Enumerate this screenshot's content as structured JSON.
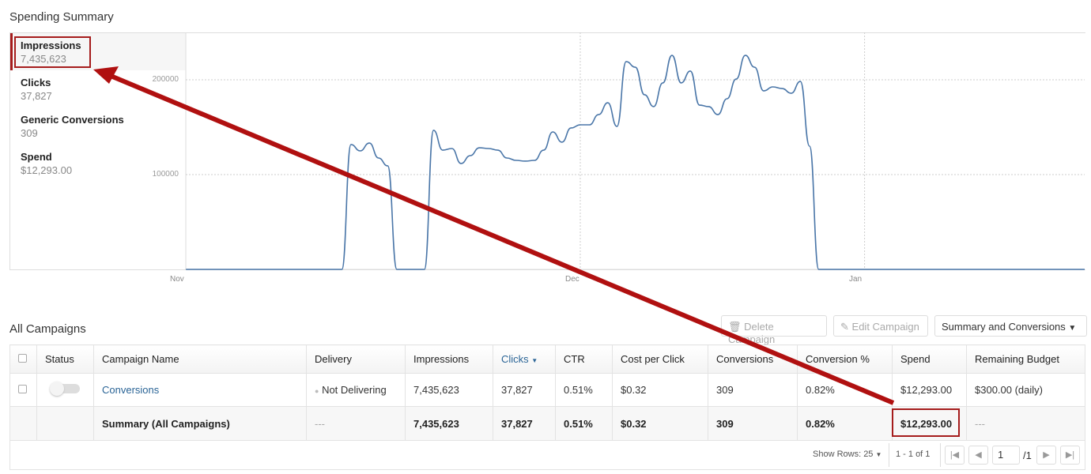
{
  "spending_title": "Spending Summary",
  "metrics": [
    {
      "name": "Impressions",
      "value": "7,435,623",
      "selected": true
    },
    {
      "name": "Clicks",
      "value": "37,827"
    },
    {
      "name": "Generic Conversions",
      "value": "309"
    },
    {
      "name": "Spend",
      "value": "$12,293.00"
    }
  ],
  "colors": {
    "line": "#4a76a8",
    "accent": "#a51c1c",
    "link": "#2a6496"
  },
  "chart_data": {
    "type": "line",
    "y_ticks": [
      "200000",
      "100000"
    ],
    "x_ticks": [
      "Nov",
      "Dec",
      "Jan"
    ],
    "ylim": [
      0,
      250000
    ],
    "xlim": [
      "Oct 19",
      "Jan 25"
    ],
    "grid": true,
    "series": [
      {
        "points": [
          [
            "Oct 19",
            0
          ],
          [
            "Nov 5",
            0
          ],
          [
            "Nov 6",
            131700
          ],
          [
            "Nov 7",
            125000
          ],
          [
            "Nov 8",
            133300
          ],
          [
            "Nov 9",
            117500
          ],
          [
            "Nov 10",
            109200
          ],
          [
            "Nov 11",
            0
          ],
          [
            "Nov 14",
            0
          ],
          [
            "Nov 15",
            146700
          ],
          [
            "Nov 16",
            125800
          ],
          [
            "Nov 17",
            127500
          ],
          [
            "Nov 18",
            111700
          ],
          [
            "Nov 19",
            120000
          ],
          [
            "Nov 20",
            128300
          ],
          [
            "Nov 21",
            127500
          ],
          [
            "Nov 22",
            125800
          ],
          [
            "Nov 23",
            117500
          ],
          [
            "Nov 24",
            115000
          ],
          [
            "Nov 25",
            114200
          ],
          [
            "Nov 26",
            115000
          ],
          [
            "Nov 27",
            125800
          ],
          [
            "Nov 28",
            145000
          ],
          [
            "Nov 29",
            134200
          ],
          [
            "Nov 30",
            149200
          ],
          [
            "Dec 1",
            152500
          ],
          [
            "Dec 2",
            152500
          ],
          [
            "Dec 3",
            163300
          ],
          [
            "Dec 4",
            175800
          ],
          [
            "Dec 5",
            150800
          ],
          [
            "Dec 6",
            219200
          ],
          [
            "Dec 7",
            213300
          ],
          [
            "Dec 8",
            184200
          ],
          [
            "Dec 9",
            171700
          ],
          [
            "Dec 10",
            196700
          ],
          [
            "Dec 11",
            225800
          ],
          [
            "Dec 12",
            196700
          ],
          [
            "Dec 13",
            209200
          ],
          [
            "Dec 14",
            173300
          ],
          [
            "Dec 15",
            171700
          ],
          [
            "Dec 16",
            163300
          ],
          [
            "Dec 17",
            180000
          ],
          [
            "Dec 18",
            200800
          ],
          [
            "Dec 19",
            225800
          ],
          [
            "Dec 20",
            213300
          ],
          [
            "Dec 21",
            188300
          ],
          [
            "Dec 22",
            192500
          ],
          [
            "Dec 23",
            190800
          ],
          [
            "Dec 24",
            185800
          ],
          [
            "Dec 25",
            198300
          ],
          [
            "Dec 26",
            130000
          ],
          [
            "Dec 27",
            0
          ],
          [
            "Jan 25",
            0
          ]
        ]
      }
    ]
  },
  "campaigns_title": "All Campaigns",
  "toolbar": {
    "delete": "Delete Campaign",
    "edit": "Edit Campaign",
    "view": "Summary and Conversions"
  },
  "table": {
    "headers": [
      "Status",
      "Campaign Name",
      "Delivery",
      "Impressions",
      "Clicks",
      "CTR",
      "Cost per Click",
      "Conversions",
      "Conversion %",
      "Spend",
      "Remaining Budget"
    ],
    "row": {
      "name": "Conversions",
      "delivery": "Not Delivering",
      "impressions": "7,435,623",
      "clicks": "37,827",
      "ctr": "0.51%",
      "cpc": "$0.32",
      "conversions": "309",
      "conv_pct": "0.82%",
      "spend": "$12,293.00",
      "budget": "$300.00 (daily)"
    },
    "summary": {
      "name": "Summary (All Campaigns)",
      "delivery": "---",
      "impressions": "7,435,623",
      "clicks": "37,827",
      "ctr": "0.51%",
      "cpc": "$0.32",
      "conversions": "309",
      "conv_pct": "0.82%",
      "spend": "$12,293.00",
      "budget": "---"
    }
  },
  "footer": {
    "show_rows": "Show Rows: 25",
    "range": "1 - 1 of 1",
    "page": "1",
    "total": "/1"
  }
}
